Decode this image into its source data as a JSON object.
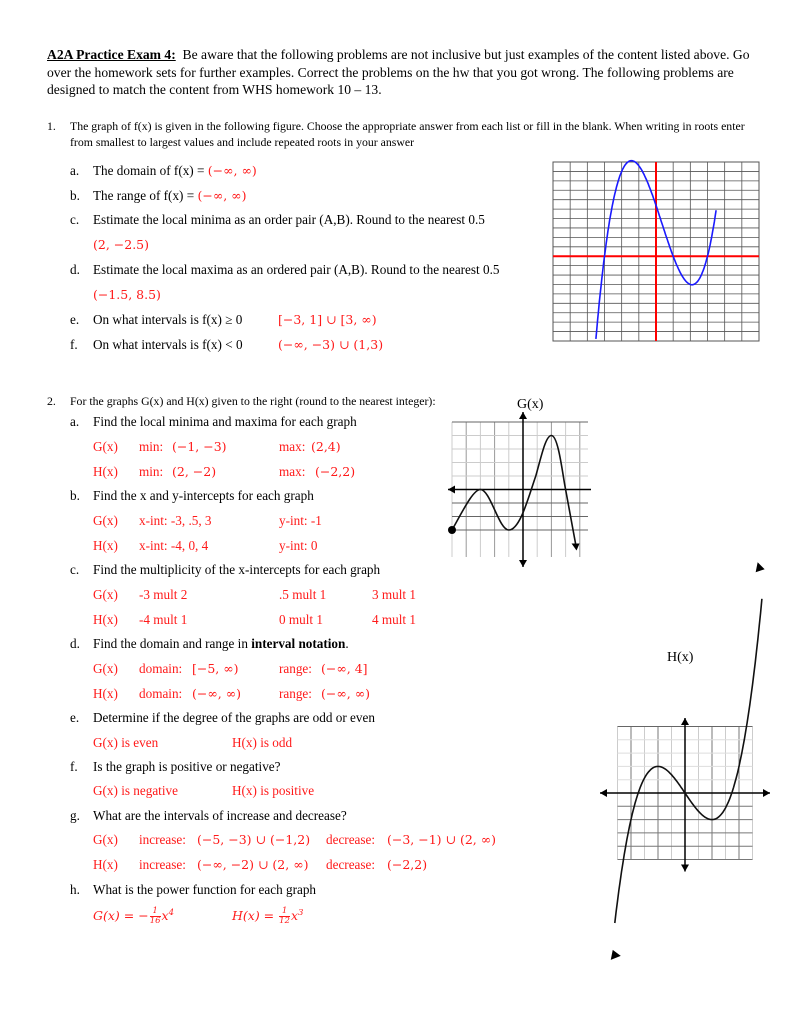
{
  "header": {
    "title": "A2A Practice Exam 4:",
    "intro": "Be aware that the following problems are not inclusive but just examples of the content listed above.  Go over the homework sets for further examples.  Correct the problems on the hw that you got wrong.  The following problems are designed to match the content from WHS homework 10 – 13."
  },
  "q1": {
    "number": "1.",
    "prompt": "The graph of f(x) is given in the following figure.  Choose the appropriate answer from each list or fill in the blank.  When writing in roots enter from smallest to largest values and include repeated roots in your answer",
    "items": [
      {
        "label": "a.",
        "text": "The domain of f(x) = ",
        "answer": "(−∞, ∞)"
      },
      {
        "label": "b.",
        "text": "The range of f(x) = ",
        "answer": "(−∞, ∞)"
      },
      {
        "label": "c.",
        "text": "Estimate the local minima as an order pair (A,B).  Round to the nearest 0.5",
        "answer": "(2, −2.5)"
      },
      {
        "label": "d.",
        "text": "Estimate the local maxima as an ordered pair (A,B).  Round to the nearest 0.5",
        "answer": "(−1.5, 8.5)"
      },
      {
        "label": "e.",
        "text": "On what intervals is f(x) ≥ 0",
        "answer": "[−3, 1] ∪ [3, ∞)"
      },
      {
        "label": "f.",
        "text": "On what intervals is f(x) < 0",
        "answer": "(−∞, −3) ∪ (1,3)"
      }
    ],
    "graph": {
      "x_range": [
        -6,
        6
      ],
      "y_range": [
        -9,
        10
      ],
      "axis_color": "#ff0000",
      "curve_color": "#1a1aff",
      "roots": [
        -3,
        1,
        3
      ],
      "local_max": [
        -1.5,
        8.5
      ],
      "local_min": [
        2,
        -2.5
      ]
    }
  },
  "q2": {
    "number": "2.",
    "prompt": "For the graphs G(x) and H(x) given to the right (round to the nearest integer):",
    "graph_g_label": "G(x)",
    "graph_h_label": "H(x)",
    "a": {
      "label": "a.",
      "text": "Find the local minima and maxima for each graph",
      "rows": [
        {
          "fn": "G(x)",
          "min_label": "min:",
          "min": "(−1, −3)",
          "max_label": "max:",
          "max": "(2,4)"
        },
        {
          "fn": "H(x)",
          "min_label": "min:",
          "min": "(2, −2)",
          "max_label": "max:",
          "max": "(−2,2)"
        }
      ]
    },
    "b": {
      "label": "b.",
      "text": "Find the x and y-intercepts for each graph",
      "rows": [
        {
          "fn": "G(x)",
          "xint": "x-int:  -3, .5, 3",
          "yint": "y-int:  -1"
        },
        {
          "fn": "H(x)",
          "xint": "x-int:  -4, 0, 4",
          "yint": "y-int:  0"
        }
      ]
    },
    "c": {
      "label": "c.",
      "text": "Find the multiplicity of  the x-intercepts for each graph",
      "rows": [
        {
          "fn": "G(x)",
          "m1": "-3 mult 2",
          "m2": ".5 mult 1",
          "m3": "3 mult 1"
        },
        {
          "fn": "H(x)",
          "m1": "-4 mult 1",
          "m2": "0  mult 1",
          "m3": "4 mult 1"
        }
      ]
    },
    "d": {
      "label": "d.",
      "text": "Find the domain and range in ",
      "text_bold": "interval notation",
      "text_end": ".",
      "rows": [
        {
          "fn": "G(x)",
          "domain_label": "domain:",
          "domain": "[−5, ∞)",
          "range_label": "range:",
          "range": "(−∞, 4]"
        },
        {
          "fn": "H(x)",
          "domain_label": "domain:",
          "domain": "(−∞, ∞)",
          "range_label": "range:",
          "range": "(−∞, ∞)"
        }
      ]
    },
    "e": {
      "label": "e.",
      "text": "Determine if the degree of the graphs are odd or even",
      "g": "G(x) is even",
      "h": "H(x) is odd"
    },
    "f": {
      "label": "f.",
      "text": "Is the graph is positive or negative?",
      "g": "G(x) is negative",
      "h": "H(x) is positive"
    },
    "g": {
      "label": "g.",
      "text": "What are the intervals of increase and decrease?",
      "rows": [
        {
          "fn": "G(x)",
          "inc_label": "increase:",
          "inc": "(−5, −3) ∪ (−1,2)",
          "dec_label": "decrease:",
          "dec": "(−3, −1) ∪ (2, ∞)"
        },
        {
          "fn": "H(x)",
          "inc_label": "increase:",
          "inc": "(−∞, −2) ∪ (2, ∞)",
          "dec_label": "decrease:",
          "dec": "(−2,2)"
        }
      ]
    },
    "h": {
      "label": "h.",
      "text": "What is the power function for each graph",
      "g_lhs": "G(x) = −",
      "g_num": "1",
      "g_den": "16",
      "g_var": "x",
      "g_exp": "4",
      "h_lhs": "H(x) = ",
      "h_num": "1",
      "h_den": "12",
      "h_var": "x",
      "h_exp": "3"
    }
  }
}
